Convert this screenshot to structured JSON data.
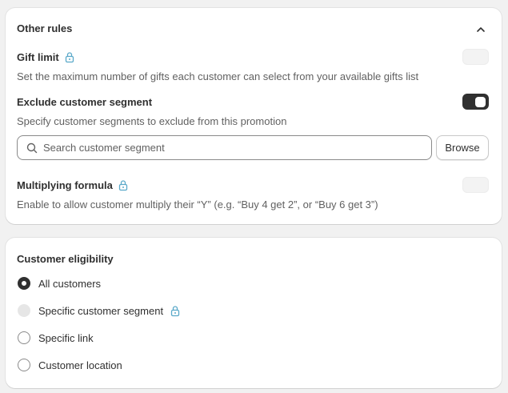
{
  "other_rules": {
    "title": "Other rules",
    "gift_limit": {
      "label": "Gift limit",
      "description": "Set the maximum number of gifts each customer can select from your available gifts list",
      "enabled": false,
      "locked": true
    },
    "exclude_segment": {
      "label": "Exclude customer segment",
      "description": "Specify customer segments to exclude from this promotion",
      "enabled": true,
      "search_placeholder": "Search customer segment",
      "browse_label": "Browse"
    },
    "multiplying_formula": {
      "label": "Multiplying formula",
      "description": "Enable to allow customer multiply their “Y” (e.g. “Buy 4 get 2”, or “Buy 6 get 3”)",
      "enabled": false,
      "locked": true
    }
  },
  "customer_eligibility": {
    "title": "Customer eligibility",
    "options": [
      {
        "label": "All customers",
        "selected": true,
        "disabled": false,
        "locked": false
      },
      {
        "label": "Specific customer segment",
        "selected": false,
        "disabled": true,
        "locked": true
      },
      {
        "label": "Specific link",
        "selected": false,
        "disabled": false,
        "locked": false
      },
      {
        "label": "Customer location",
        "selected": false,
        "disabled": false,
        "locked": false
      }
    ]
  },
  "colors": {
    "lock_icon": "#5aa9c9",
    "toggle_on": "#303030",
    "text_primary": "#303030",
    "text_secondary": "#616161"
  },
  "icons": [
    "chevron-up-icon",
    "lock-icon",
    "search-icon"
  ]
}
